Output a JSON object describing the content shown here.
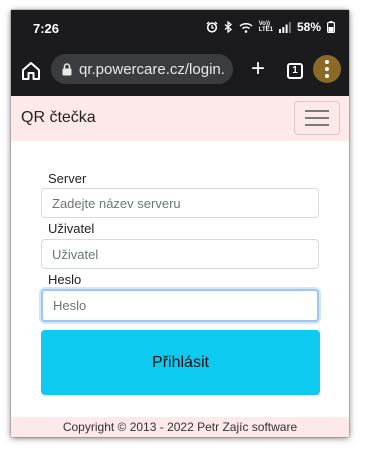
{
  "status_bar": {
    "time": "7:26",
    "alarm_icon": "alarm-icon",
    "bluetooth_icon": "bluetooth-icon",
    "wifi_icon": "wifi-icon",
    "volte_label": "Vo))\nLTE1",
    "signal_icon": "signal-icon",
    "battery": "58%",
    "battery_icon": "battery-icon"
  },
  "browser": {
    "url": "qr.powercare.cz/login.",
    "tab_count": "1",
    "home_icon": "home-icon",
    "lock_icon": "lock-icon",
    "new_tab_icon": "plus-icon",
    "menu_icon": "more-vertical-icon",
    "menu_color": "#8a6a26"
  },
  "navbar": {
    "brand": "QR čtečka",
    "toggler_icon": "hamburger-icon",
    "bg_color": "#fde8ea"
  },
  "login_form": {
    "server_label": "Server",
    "server_placeholder": "Zadejte název serveru",
    "user_label": "Uživatel",
    "user_placeholder": "Uživatel",
    "password_label": "Heslo",
    "password_placeholder": "Heslo",
    "submit_label": "Přihlásit",
    "submit_color": "#0dcaf0"
  },
  "footer": {
    "copyright": "Copyright © 2013 - 2022 Petr Zajíc software"
  }
}
